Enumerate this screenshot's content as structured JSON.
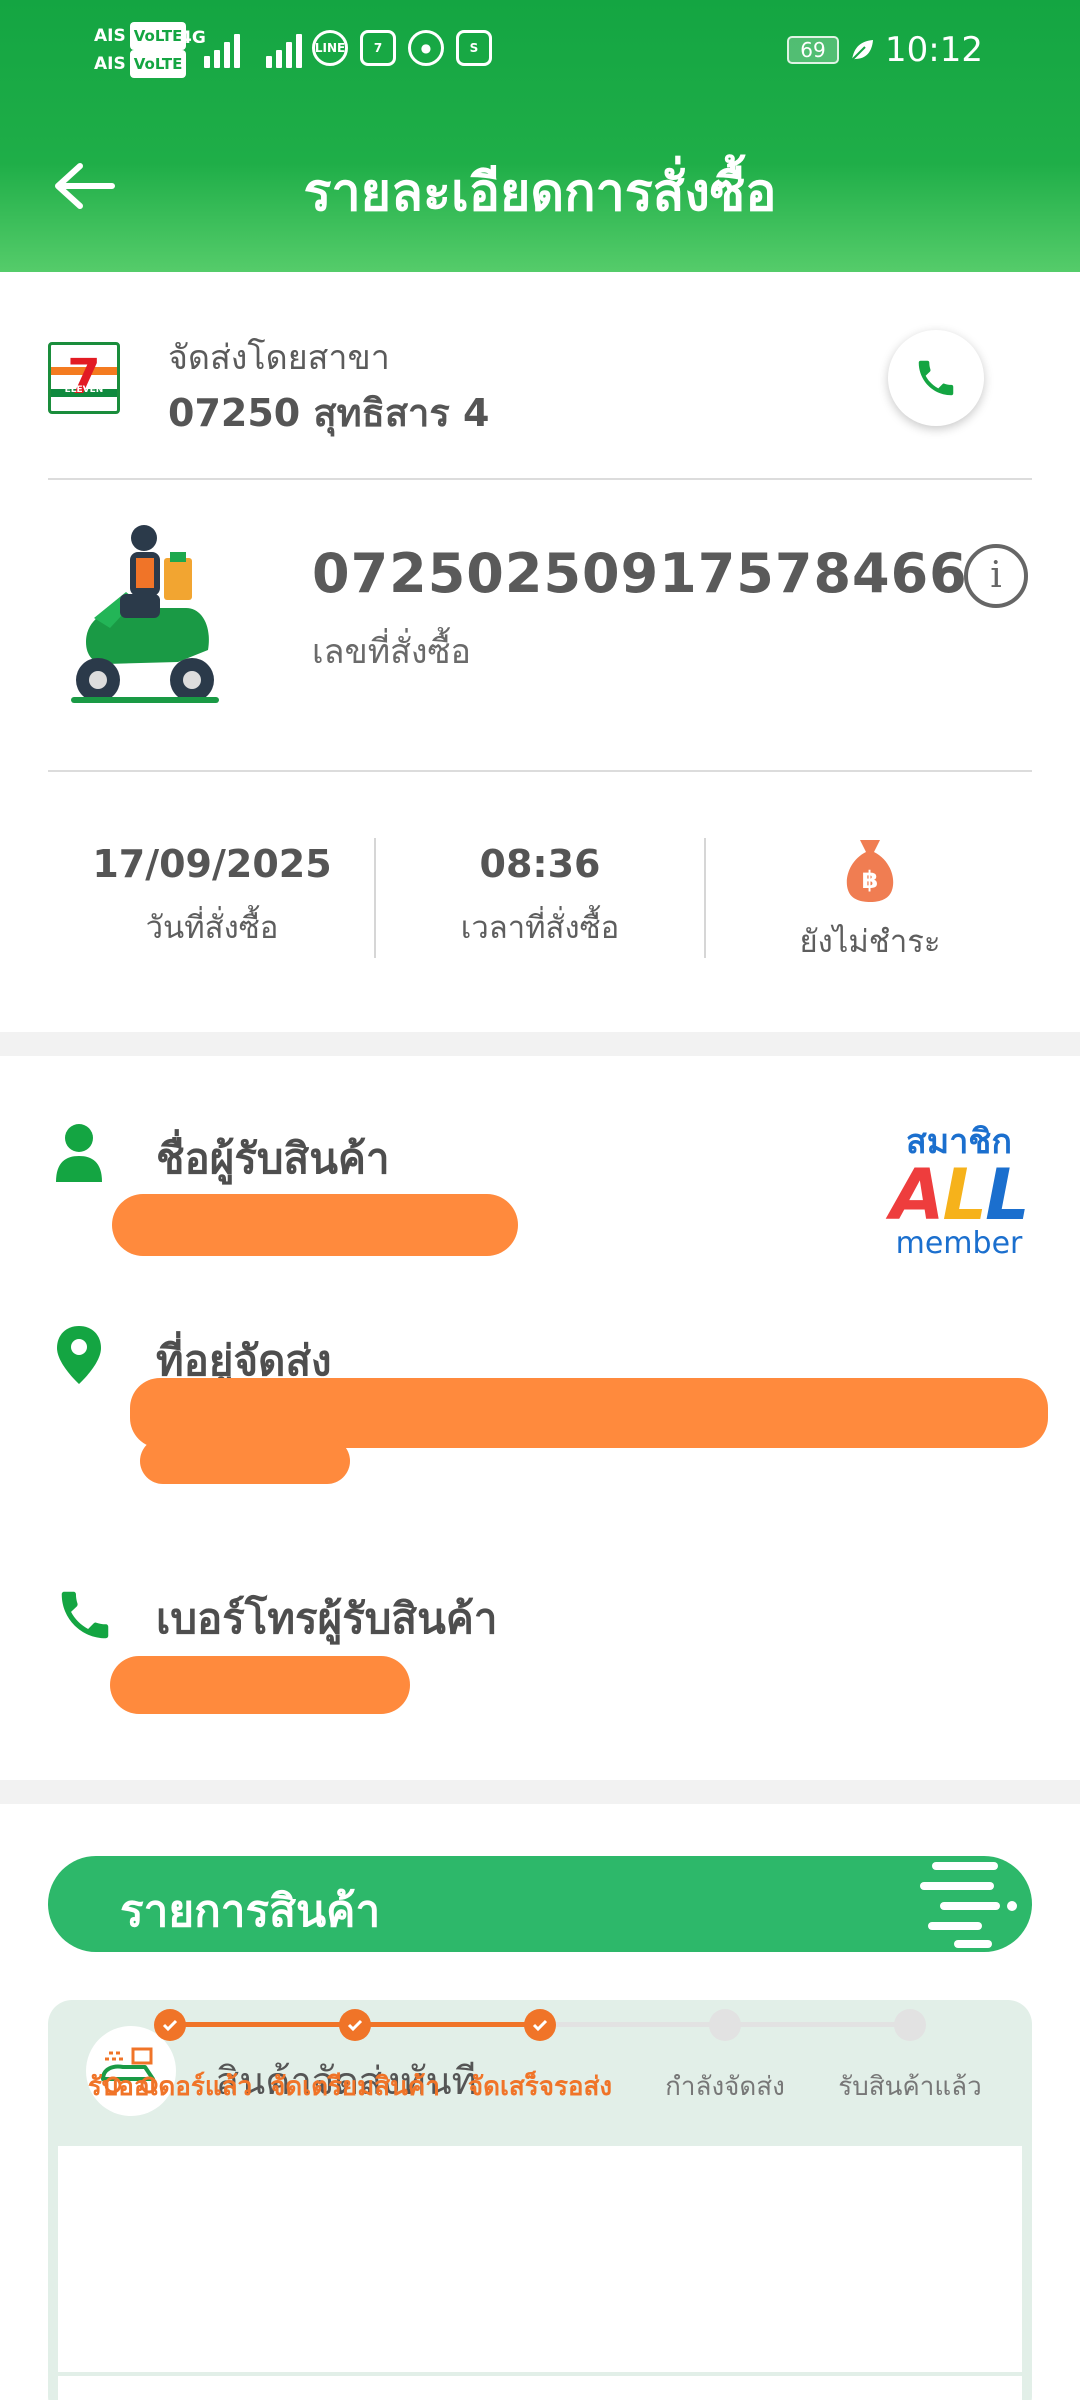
{
  "status_bar": {
    "carrier_1": "AIS",
    "carrier_2": "AIS",
    "volte": "VoLTE",
    "network": "4G",
    "battery": "69",
    "time": "10:12",
    "app_icons": [
      "line-icon",
      "seven-eleven-app-icon",
      "maps-icon",
      "shopee-icon"
    ]
  },
  "header": {
    "title": "รายละเอียดการสั่งซื้อ"
  },
  "store": {
    "caption": "จัดส่งโดยสาขา",
    "branch": "07250 สุทธิสาร 4"
  },
  "order": {
    "number": "07250250917578466",
    "number_caption": "เลขที่สั่งซื้อ",
    "date": "17/09/2025",
    "date_label": "วันที่สั่งซื้อ",
    "time": "08:36",
    "time_label": "เวลาที่สั่งซื้อ",
    "payment_label": "ยังไม่ชำระ"
  },
  "recipient": {
    "name_heading": "ชื่อผู้รับสินค้า",
    "address_heading": "ที่อยู่จัดส่ง",
    "phone_heading": "เบอร์โทรผู้รับสินค้า"
  },
  "all_member": {
    "top": "สมาชิก",
    "logo_a": "A",
    "logo_l1": "L",
    "logo_l2": "L",
    "bottom": "member"
  },
  "items": {
    "title": "รายการสินค้า",
    "delivery_type": "สินค้าจัดส่งทันที",
    "steps": [
      {
        "label": "รับออเดอร์แล้ว",
        "done": true
      },
      {
        "label": "จัดเตรียมสินค้า",
        "done": true
      },
      {
        "label": "จัดเสร็จรอส่ง",
        "done": true
      },
      {
        "label": "กำลังจัดส่ง",
        "done": false
      },
      {
        "label": "รับสินค้าแล้ว",
        "done": false
      }
    ]
  },
  "colors": {
    "brand_green": "#14a542",
    "accent_orange": "#f07428",
    "items_banner": "#2db86a"
  }
}
